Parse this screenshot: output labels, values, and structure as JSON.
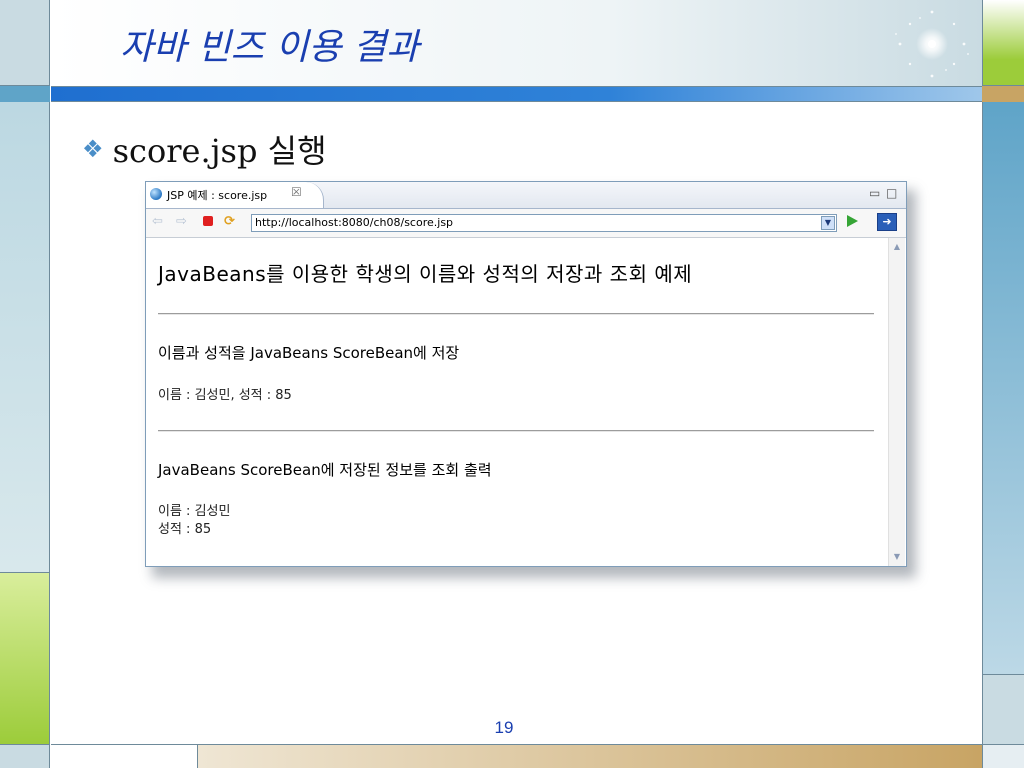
{
  "slide": {
    "title": "자바 빈즈 이용 결과",
    "bullet_icon": "❖",
    "bullet_text": "score.jsp 실행",
    "page_number": "19"
  },
  "browser": {
    "tab_label": "JSP 예제 : score.jsp",
    "url": "http://localhost:8080/ch08/score.jsp",
    "icons": [
      "globe-icon",
      "tab-close-icon",
      "minimize-icon",
      "maximize-icon",
      "back-arrow-icon",
      "forward-arrow-icon",
      "stop-icon",
      "refresh-icon",
      "url-dropdown-icon",
      "go-icon",
      "navigator-icon"
    ]
  },
  "page": {
    "title": "JavaBeans를 이용한 학생의 이름와 성적의 저장과 조회 예제",
    "section1_heading": "이름과 성적을 JavaBeans ScoreBean에 저장",
    "section1_text": "이름 : 김성민, 성적 : 85",
    "section2_heading": "JavaBeans ScoreBean에 저장된 정보를 조회 출력",
    "section2_name": "이름 : 김성민",
    "section2_score": "성적 : 85"
  },
  "colors": {
    "title_blue": "#1a3fb0",
    "accent_blue": "#4a8ec8",
    "green": "#9ccc3a",
    "teal": "#5fa4c8",
    "tan": "#c8a464"
  }
}
